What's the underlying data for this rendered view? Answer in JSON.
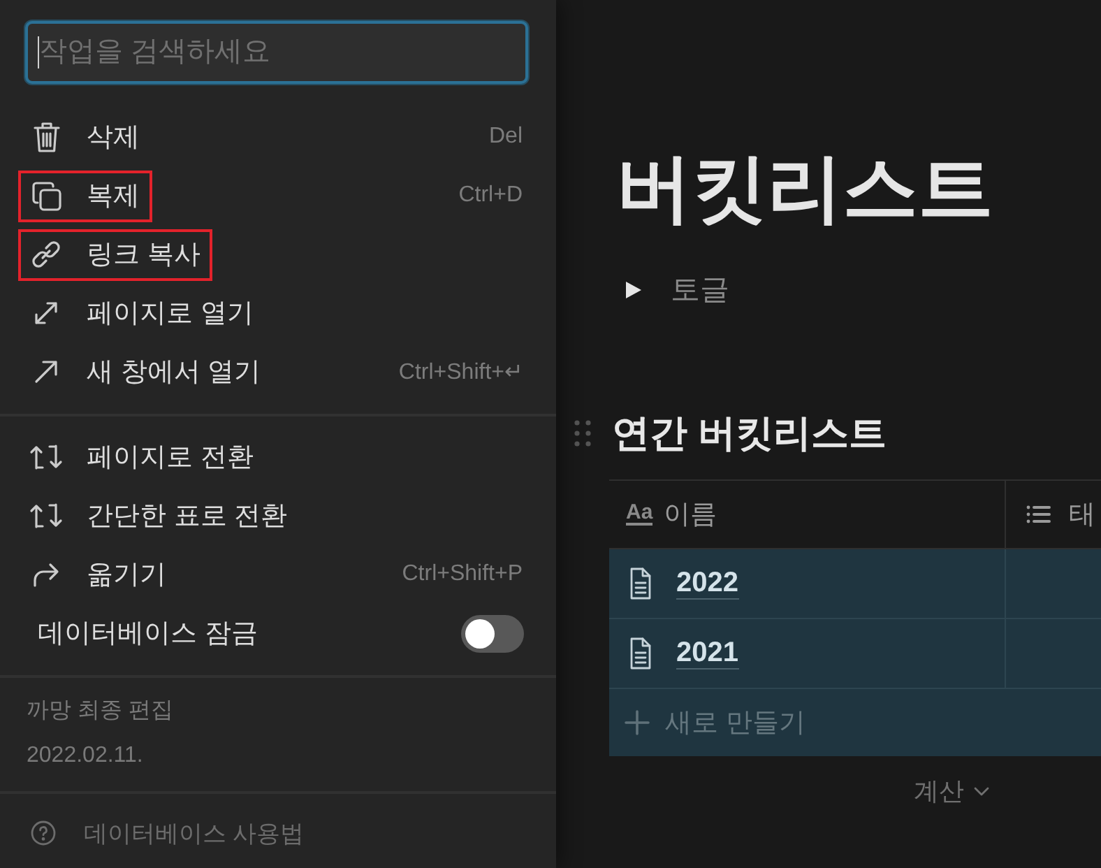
{
  "menu": {
    "search": {
      "placeholder": "작업을 검색하세요"
    },
    "groups": [
      {
        "items": [
          {
            "kind": "delete",
            "label": "삭제",
            "shortcut": "Del",
            "highlighted": false
          },
          {
            "kind": "duplicate",
            "label": "복제",
            "shortcut": "Ctrl+D",
            "highlighted": true
          },
          {
            "kind": "copy_link",
            "label": "링크 복사",
            "highlighted": true
          },
          {
            "kind": "open_page",
            "label": "페이지로 열기",
            "highlighted": false
          },
          {
            "kind": "open_window",
            "label": "새 창에서 열기",
            "shortcut": "Ctrl+Shift+↵",
            "highlighted": false
          }
        ]
      },
      {
        "items": [
          {
            "kind": "convert",
            "label": "페이지로 전환",
            "highlighted": false
          },
          {
            "kind": "convert",
            "label": "간단한 표로 전환",
            "highlighted": false
          },
          {
            "kind": "move",
            "label": "옮기기",
            "shortcut": "Ctrl+Shift+P",
            "highlighted": false
          },
          {
            "kind": "switch",
            "label": "데이터베이스 잠금",
            "on": false,
            "highlighted": false
          }
        ]
      }
    ],
    "last_edited": {
      "label": "까망 최종 편집",
      "date": "2022.02.11."
    },
    "help": {
      "label": "데이터베이스 사용법"
    }
  },
  "page": {
    "title": "버킷리스트",
    "toggle": {
      "label": "토글",
      "expanded": false
    },
    "database": {
      "title": "연간 버킷리스트",
      "columns": [
        {
          "kind": "title",
          "type_label": "Aa",
          "label": "이름"
        },
        {
          "kind": "multi_select",
          "label": "태"
        }
      ],
      "rows": [
        {
          "name": "2022",
          "selected": true
        },
        {
          "name": "2021",
          "selected": true
        }
      ],
      "new_row": {
        "label": "새로 만들기",
        "selected": true
      },
      "calculate": {
        "label": "계산"
      }
    }
  }
}
